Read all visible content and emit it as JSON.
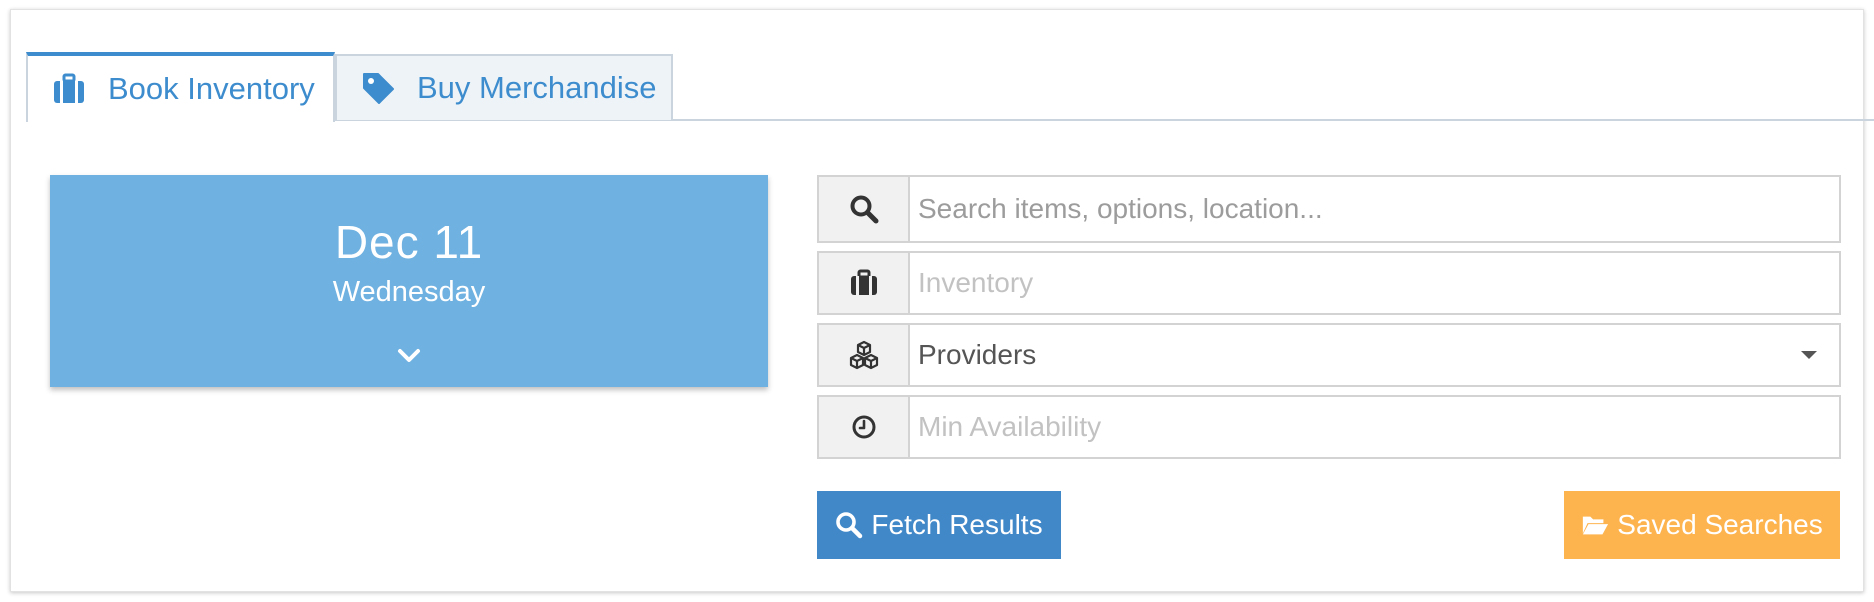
{
  "tabs": [
    {
      "label": "Book Inventory",
      "icon": "briefcase-icon",
      "active": true
    },
    {
      "label": "Buy Merchandise",
      "icon": "tag-icon",
      "active": false
    }
  ],
  "date_card": {
    "date": "Dec 11",
    "weekday": "Wednesday",
    "icon": "chevron-down-icon"
  },
  "form": {
    "search": {
      "placeholder": "Search items, options, location...",
      "value": "",
      "icon": "search-icon"
    },
    "inventory": {
      "placeholder": "Inventory",
      "value": "",
      "icon": "briefcase-icon"
    },
    "providers": {
      "selected": "Providers",
      "icon": "cubes-icon"
    },
    "min_availability": {
      "placeholder": "Min Availability",
      "value": "",
      "icon": "clock-icon"
    }
  },
  "buttons": {
    "fetch_label": "Fetch Results",
    "saved_label": "Saved Searches"
  },
  "colors": {
    "accent": "#3d8ccd",
    "date_card_bg": "#6fb1e0",
    "fetch_button": "#4188c9",
    "saved_button": "#fdb44f"
  }
}
